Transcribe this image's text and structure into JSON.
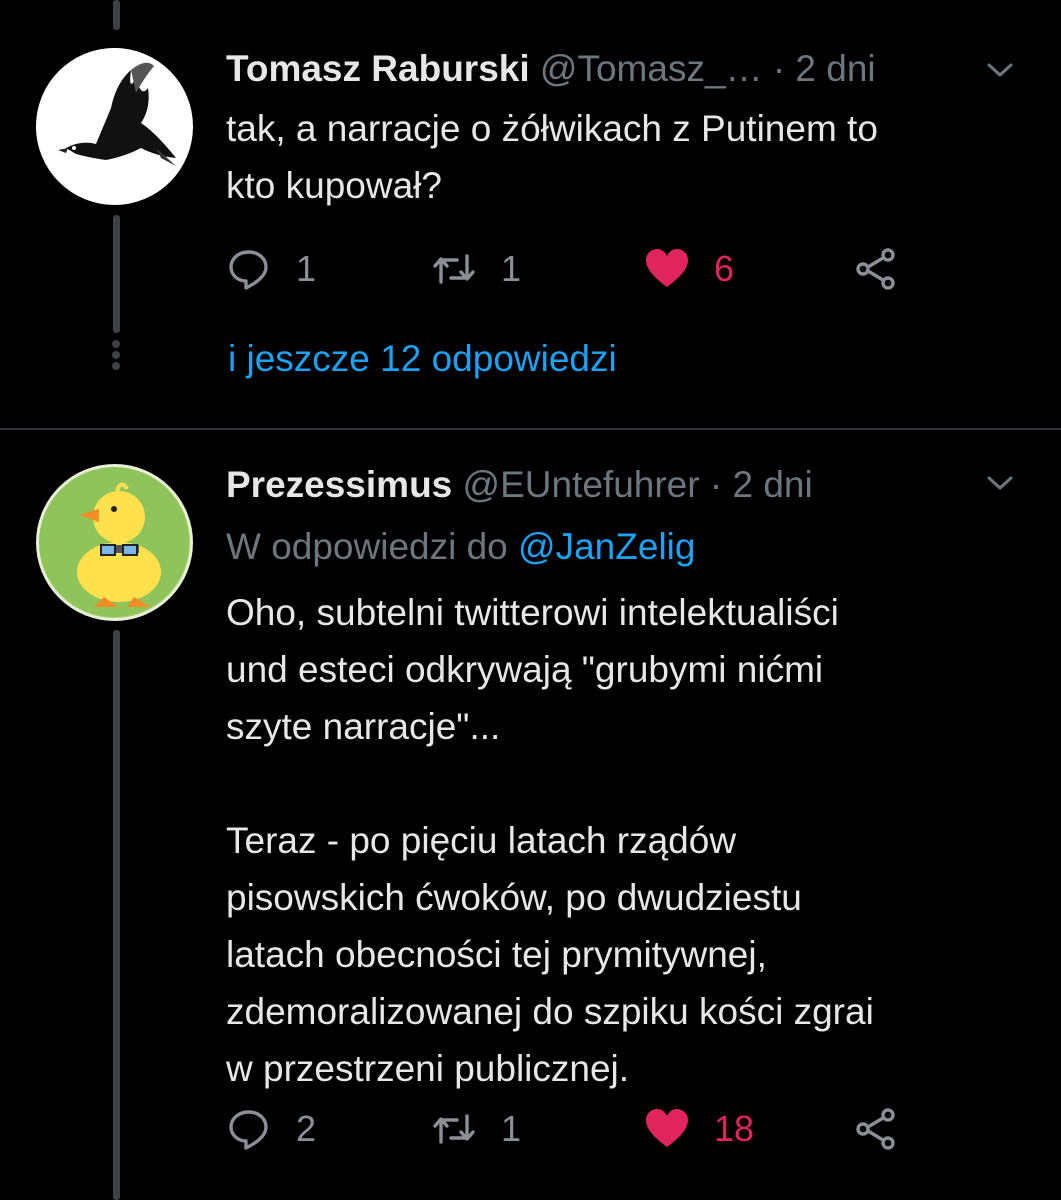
{
  "tweets": [
    {
      "name": "Tomasz Raburski",
      "handle": "@Tomasz_…",
      "time": "· 2 dni",
      "text": "tak, a narracje o żółwikach z Putinem to\nkto kupował?",
      "replies": "1",
      "retweets": "1",
      "likes": "6",
      "liked": true
    },
    {
      "name": "Prezessimus",
      "handle": "@EUntefuhrer",
      "time": "· 2 dni",
      "reply_prefix": "W odpowiedzi do",
      "reply_to": "@JanZelig",
      "text": "Oho, subtelni twitterowi intelektualiści\nund esteci odkrywają \"grubymi nićmi\nszyte narracje\"...\n\nTeraz - po pięciu latach rządów\npisowskich ćwoków, po dwudziestu\nlatach obecności tej prymitywnej,\nzdemoralizowanej do szpiku kości zgrai\nw przestrzeni publicznej.",
      "replies": "2",
      "retweets": "1",
      "likes": "18",
      "liked": true
    }
  ],
  "more_replies": "i jeszcze 12 odpowiedzi",
  "colors": {
    "accent": "#1da1f2",
    "like": "#e0245e",
    "muted": "#6e767d",
    "bg": "#000000"
  },
  "icons": [
    "reply-icon",
    "retweet-icon",
    "heart-icon",
    "share-icon",
    "chevron-down-icon"
  ]
}
